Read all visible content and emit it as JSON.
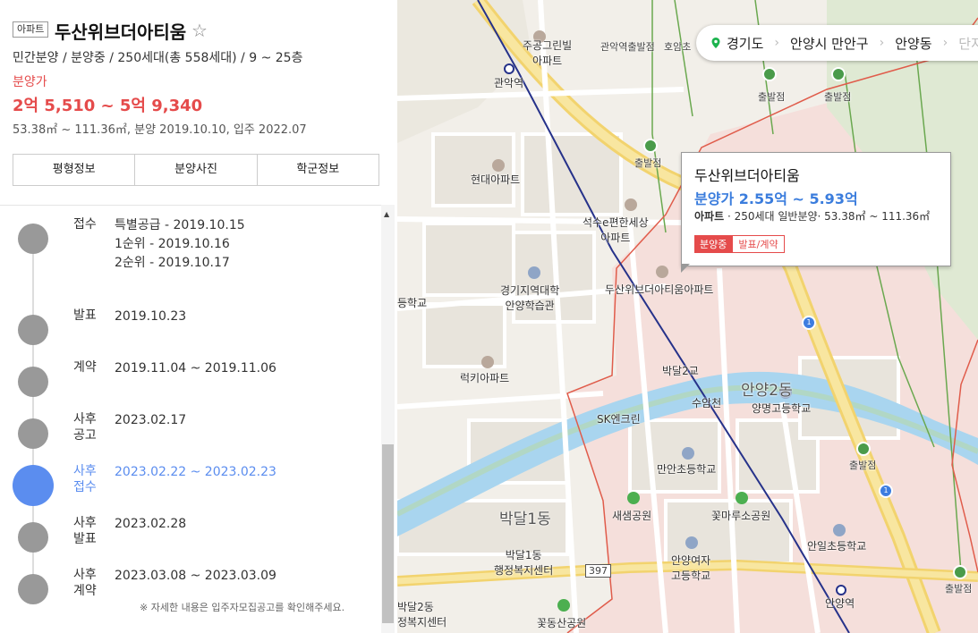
{
  "apartment": {
    "type_badge": "아파트",
    "name": "두산위브더아티움",
    "meta": "민간분양 / 분양중 / 250세대(총 558세대) / 9 ~ 25층",
    "price_label": "분양가",
    "price_range": "2억 5,510 ~ 5억 9,340",
    "area_dates": "53.38㎡ ~ 111.36㎡, 분양 2019.10.10, 입주 2022.07"
  },
  "tabs": [
    "평형정보",
    "분양사진",
    "학군정보"
  ],
  "timeline": [
    {
      "label": "접수",
      "lines": [
        "특별공급 - 2019.10.15",
        "1순위 - 2019.10.16",
        "2순위 - 2019.10.17"
      ]
    },
    {
      "label": "발표",
      "lines": [
        "2019.10.23"
      ]
    },
    {
      "label": "계약",
      "lines": [
        "2019.11.04 ~ 2019.11.06"
      ]
    },
    {
      "label": "사후\n공고",
      "lines": [
        "2023.02.17"
      ]
    },
    {
      "label": "사후\n접수",
      "lines": [
        "2023.02.22 ~ 2023.02.23"
      ],
      "active": true
    },
    {
      "label": "사후\n발표",
      "lines": [
        "2023.02.28"
      ]
    },
    {
      "label": "사후\n계약",
      "lines": [
        "2023.03.08 ~ 2023.03.09"
      ]
    }
  ],
  "note": "※ 자세한 내용은 입주자모집공고를 확인해주세요.",
  "breadcrumb": [
    "경기도",
    "안양시 만안구",
    "안양동",
    "단지"
  ],
  "info_card": {
    "name": "두산위브더아티움",
    "price": "분양가 2.55억 ~ 5.93억",
    "meta_type": "아파트",
    "meta_rest": " · 250세대 일반분양· 53.38㎡ ~ 111.36㎡",
    "badge_status": "분양중",
    "badge_stage": "발표/계약"
  },
  "map_labels": {
    "gwanak_station": "관악역",
    "jugong": "주공그린빌\n아파트",
    "gwanak_bus": "관악역출발점",
    "hoam": "호암초",
    "chulbal1": "출발점",
    "chulbal2": "출발점",
    "chulbal3": "출발점",
    "chulbal4": "출발점",
    "chulbal5": "출발점",
    "hyundai": "현대아파트",
    "seoksu": "석수e편한세상\n아파트",
    "doosan_apt": "두산위브더아티움아파트",
    "gyeonggi_univ": "경기지역대학\n안양학습관",
    "school_left": "등학교",
    "lucky": "럭키아파트",
    "bakdal2": "박달2교",
    "suamcheon": "수암천",
    "anyang2": "안양2동",
    "yangmyeong": "양명고등학교",
    "sk": "SK엔크린",
    "manan_elem": "만안초등학교",
    "saesaem": "새샘공원",
    "kkotmaru": "꽃마루소공원",
    "bakdal1": "박달1동",
    "bakdal1_center": "박달1동\n행정복지센터",
    "anyang_girls": "안양여자\n고등학교",
    "anil": "안일초등학교",
    "bakdal2dong": "박달2동\n정복지센터",
    "kkotdong": "꽃동산공원",
    "anyang_station": "안양역",
    "route397": "397",
    "hwy1": "1"
  },
  "colors": {
    "price_red": "#e54b4b",
    "active_blue": "#5b8def",
    "card_blue": "#3b7ddd"
  }
}
